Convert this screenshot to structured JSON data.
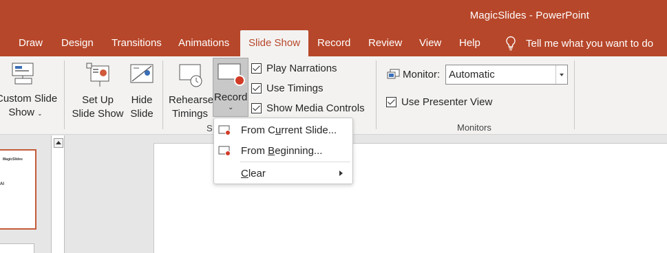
{
  "window": {
    "title": "MagicSlides  -  PowerPoint"
  },
  "tabs": [
    {
      "label": "Draw"
    },
    {
      "label": "Design"
    },
    {
      "label": "Transitions"
    },
    {
      "label": "Animations"
    },
    {
      "label": "Slide Show",
      "active": true
    },
    {
      "label": "Record"
    },
    {
      "label": "Review"
    },
    {
      "label": "View"
    },
    {
      "label": "Help"
    }
  ],
  "tell_me": {
    "label": "Tell me what you want to do"
  },
  "ribbon": {
    "custom_slide_show": {
      "line1": "Custom Slide",
      "line2": "Show"
    },
    "set_up": {
      "line1": "Set Up",
      "line2": "Slide Show"
    },
    "hide_slide": {
      "line1": "Hide",
      "line2": "Slide"
    },
    "rehearse": {
      "line1": "Rehearse",
      "line2": "Timings"
    },
    "record": {
      "label": "Record"
    },
    "checkboxes": [
      {
        "label": "Play Narrations",
        "checked": true
      },
      {
        "label": "Use Timings",
        "checked": true
      },
      {
        "label": "Show Media Controls",
        "checked": true
      }
    ],
    "group_label_partial": "S",
    "monitor": {
      "label": "Monitor:",
      "value": "Automatic"
    },
    "presenter_view": {
      "label": "Use Presenter View",
      "checked": true
    },
    "monitors_group_label": "Monitors"
  },
  "record_menu": {
    "items": [
      {
        "pre": "From C",
        "accel": "u",
        "post": "rrent Slide...",
        "icon": "record-from-current-icon"
      },
      {
        "pre": "From ",
        "accel": "B",
        "post": "eginning...",
        "icon": "record-from-beginning-icon"
      },
      {
        "pre": "",
        "accel": "C",
        "post": "lear",
        "icon": "",
        "submenu": true
      }
    ]
  },
  "thumbnail": {
    "brand": "MagicSlides",
    "text": "AI"
  },
  "colors": {
    "accent": "#b7472a",
    "ribbon": "#f3f2f1"
  }
}
